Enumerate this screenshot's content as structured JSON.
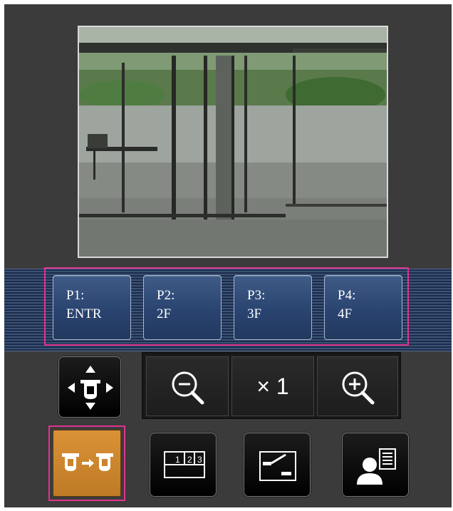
{
  "camera": {
    "image_alt": "Live camera image"
  },
  "presets": [
    {
      "line1": "P1:",
      "line2": "ENTR"
    },
    {
      "line1": "P2:",
      "line2": "2F"
    },
    {
      "line1": "P3:",
      "line2": "3F"
    },
    {
      "line1": "P4:",
      "line2": "4F"
    }
  ],
  "zoom": {
    "level": "× 1"
  },
  "icons": {
    "pan_tilt": "pan-tilt-arrows-icon",
    "zoom_out": "zoom-out-magnifier-icon",
    "zoom_in": "zoom-in-magnifier-icon",
    "camera_switch": "camera-switch-icon",
    "multi_screen": "multi-screen-icon",
    "brightness": "brightness-adjust-icon",
    "user_list": "user-list-icon"
  },
  "colors": {
    "highlight": "#e0338f",
    "accent_orange": "#d08a30",
    "preset_blue": "#2a4470",
    "background": "#3b3b3b"
  }
}
